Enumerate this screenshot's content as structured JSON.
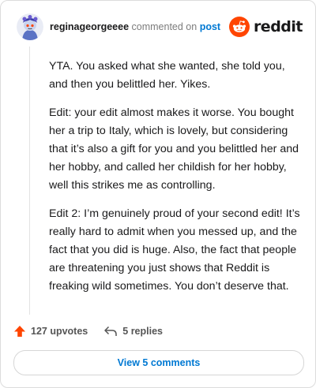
{
  "comment": {
    "username": "reginageorgeeee",
    "action_text": "commented on",
    "post_link": "post",
    "paragraphs": [
      "YTA. You asked what she wanted, she told you, and then you belittled her. Yikes.",
      "Edit: your edit almost makes it worse. You bought her a trip to Italy, which is lovely, but considering that it’s also a gift for you and you belittled her and her hobby, and called her childish for her hobby, well this strikes me as controlling.",
      "Edit 2: I’m genuinely proud of your second edit! It’s really hard to admit when you messed up, and the fact that you did is huge. Also, the fact that people are threatening you just shows that Reddit is freaking wild sometimes. You don’t deserve that."
    ]
  },
  "brand": {
    "name": "reddit",
    "color": "#ff4500"
  },
  "footer": {
    "upvotes_label": "127 upvotes",
    "replies_label": "5 replies",
    "upvote_icon": "upvote-arrow-icon",
    "reply_icon": "reply-icon"
  },
  "view_comments_label": "View 5 comments",
  "colors": {
    "link": "#0079d3",
    "upvote": "#ff4500",
    "muted": "#7c7c7c"
  }
}
